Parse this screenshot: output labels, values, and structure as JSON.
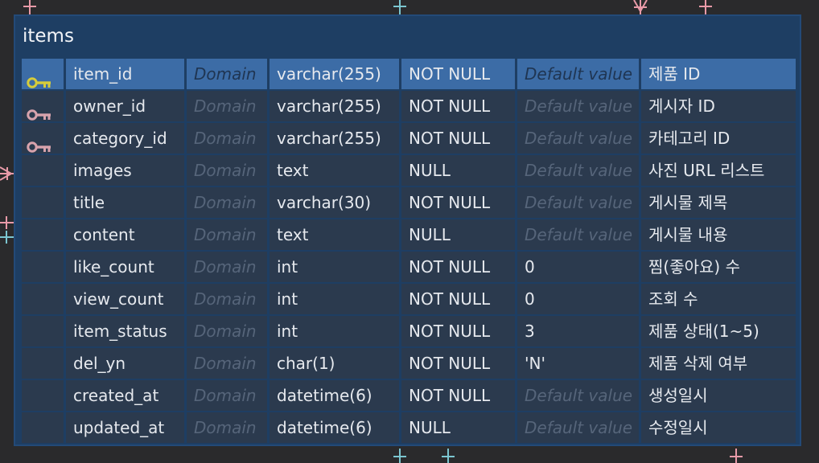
{
  "entity": {
    "title": "items",
    "columns": [
      {
        "key": "primary",
        "name": "item_id",
        "domain": "Domain",
        "type": "varchar(255)",
        "nullability": "NOT NULL",
        "default": "Default value",
        "default_is_placeholder": true,
        "comment": "제품 ID",
        "selected": true
      },
      {
        "key": "foreign",
        "name": "owner_id",
        "domain": "Domain",
        "type": "varchar(255)",
        "nullability": "NOT NULL",
        "default": "Default value",
        "default_is_placeholder": true,
        "comment": "게시자 ID"
      },
      {
        "key": "foreign",
        "name": "category_id",
        "domain": "Domain",
        "type": "varchar(255)",
        "nullability": "NOT NULL",
        "default": "Default value",
        "default_is_placeholder": true,
        "comment": "카테고리 ID"
      },
      {
        "key": "",
        "name": "images",
        "domain": "Domain",
        "type": "text",
        "nullability": "NULL",
        "default": "Default value",
        "default_is_placeholder": true,
        "comment": "사진 URL 리스트"
      },
      {
        "key": "",
        "name": "title",
        "domain": "Domain",
        "type": "varchar(30)",
        "nullability": "NOT NULL",
        "default": "Default value",
        "default_is_placeholder": true,
        "comment": "게시물 제목"
      },
      {
        "key": "",
        "name": "content",
        "domain": "Domain",
        "type": "text",
        "nullability": "NULL",
        "default": "Default value",
        "default_is_placeholder": true,
        "comment": "게시물 내용"
      },
      {
        "key": "",
        "name": "like_count",
        "domain": "Domain",
        "type": "int",
        "nullability": "NOT NULL",
        "default": "0",
        "default_is_placeholder": false,
        "comment": "찜(좋아요) 수"
      },
      {
        "key": "",
        "name": "view_count",
        "domain": "Domain",
        "type": "int",
        "nullability": "NOT NULL",
        "default": "0",
        "default_is_placeholder": false,
        "comment": "조회 수"
      },
      {
        "key": "",
        "name": "item_status",
        "domain": "Domain",
        "type": "int",
        "nullability": "NOT NULL",
        "default": "3",
        "default_is_placeholder": false,
        "comment": "제품 상태(1~5)"
      },
      {
        "key": "",
        "name": "del_yn",
        "domain": "Domain",
        "type": "char(1)",
        "nullability": "NOT NULL",
        "default": "'N'",
        "default_is_placeholder": false,
        "comment": "제품 삭제 여부"
      },
      {
        "key": "",
        "name": "created_at",
        "domain": "Domain",
        "type": "datetime(6)",
        "nullability": "NOT NULL",
        "default": "Default value",
        "default_is_placeholder": true,
        "comment": "생성일시"
      },
      {
        "key": "",
        "name": "updated_at",
        "domain": "Domain",
        "type": "datetime(6)",
        "nullability": "NULL",
        "default": "Default value",
        "default_is_placeholder": true,
        "comment": "수정일시"
      }
    ]
  },
  "colors": {
    "primary_key_icon": "#d6cc3a",
    "foreign_key_icon": "#d8a3ad",
    "connector_pink": "#e89aa8",
    "connector_teal": "#7cc6d1"
  },
  "icons": {
    "primary": "primary-key-icon",
    "foreign": "foreign-key-icon"
  }
}
